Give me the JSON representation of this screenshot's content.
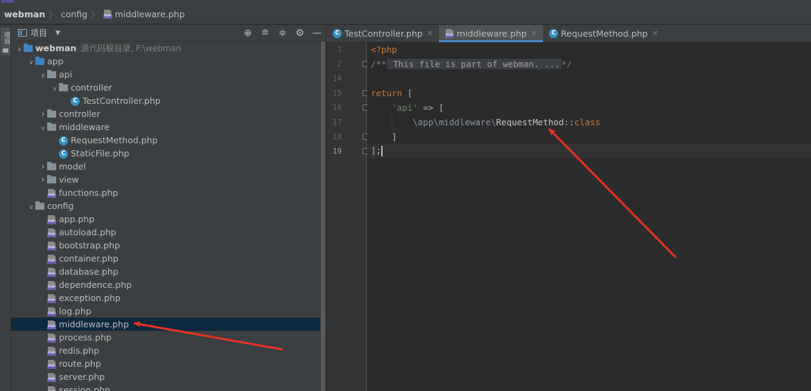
{
  "navbar": {
    "project": "webman",
    "crumb1": "config",
    "crumb2": "middleware.php"
  },
  "sidebar_tab": {
    "label": "项目"
  },
  "project_panel": {
    "title": "项目",
    "tools": [
      "target-icon",
      "expand-all-icon",
      "collapse-all-icon",
      "gear-icon",
      "minimize-icon"
    ]
  },
  "tree": [
    {
      "label": "webman",
      "hint": "源代码根目录, F:\\webman",
      "level": 0,
      "type": "folder-blue",
      "arrow": "open",
      "bold": true
    },
    {
      "label": "app",
      "level": 1,
      "type": "folder-blue",
      "arrow": "open"
    },
    {
      "label": "api",
      "level": 2,
      "type": "folder",
      "arrow": "open"
    },
    {
      "label": "controller",
      "level": 3,
      "type": "folder",
      "arrow": "open"
    },
    {
      "label": "TestController.php",
      "level": 4,
      "type": "class"
    },
    {
      "label": "controller",
      "level": 2,
      "type": "folder",
      "arrow": "closed"
    },
    {
      "label": "middleware",
      "level": 2,
      "type": "folder",
      "arrow": "open"
    },
    {
      "label": "RequestMethod.php",
      "level": 3,
      "type": "class"
    },
    {
      "label": "StaticFile.php",
      "level": 3,
      "type": "class"
    },
    {
      "label": "model",
      "level": 2,
      "type": "folder",
      "arrow": "closed"
    },
    {
      "label": "view",
      "level": 2,
      "type": "folder",
      "arrow": "closed"
    },
    {
      "label": "functions.php",
      "level": 2,
      "type": "php"
    },
    {
      "label": "config",
      "level": 1,
      "type": "folder",
      "arrow": "open"
    },
    {
      "label": "app.php",
      "level": 2,
      "type": "php"
    },
    {
      "label": "autoload.php",
      "level": 2,
      "type": "php"
    },
    {
      "label": "bootstrap.php",
      "level": 2,
      "type": "php"
    },
    {
      "label": "container.php",
      "level": 2,
      "type": "php"
    },
    {
      "label": "database.php",
      "level": 2,
      "type": "php"
    },
    {
      "label": "dependence.php",
      "level": 2,
      "type": "php"
    },
    {
      "label": "exception.php",
      "level": 2,
      "type": "php"
    },
    {
      "label": "log.php",
      "level": 2,
      "type": "php"
    },
    {
      "label": "middleware.php",
      "level": 2,
      "type": "php",
      "selected": true
    },
    {
      "label": "process.php",
      "level": 2,
      "type": "php"
    },
    {
      "label": "redis.php",
      "level": 2,
      "type": "php"
    },
    {
      "label": "route.php",
      "level": 2,
      "type": "php"
    },
    {
      "label": "server.php",
      "level": 2,
      "type": "php"
    },
    {
      "label": "session.php",
      "level": 2,
      "type": "php"
    }
  ],
  "tabs": [
    {
      "label": "TestController.php",
      "icon": "class",
      "active": false
    },
    {
      "label": "middleware.php",
      "icon": "php",
      "active": true
    },
    {
      "label": "RequestMethod.php",
      "icon": "class",
      "active": false
    }
  ],
  "code": {
    "line_numbers": [
      "1",
      "2",
      "14",
      "15",
      "16",
      "17",
      "18",
      "19"
    ],
    "lines": {
      "l1": "<?php",
      "l2_open": "/**",
      "l2_fold": " This file is part of webman. ...",
      "l2_close": "*/",
      "l15_kw": "return",
      "l15_rest": " [",
      "l16_str": "'api'",
      "l16_rest": " => [",
      "l17_ns": "\\app\\middleware\\",
      "l17_cls": "RequestMethod",
      "l17_sep": "::",
      "l17_kw": "class",
      "l18": "]",
      "l19": "];"
    }
  },
  "colors": {
    "annotation_arrow": "#ea3323",
    "selection": "#0d293e",
    "keyword": "#cc7832",
    "string": "#6a8759"
  }
}
